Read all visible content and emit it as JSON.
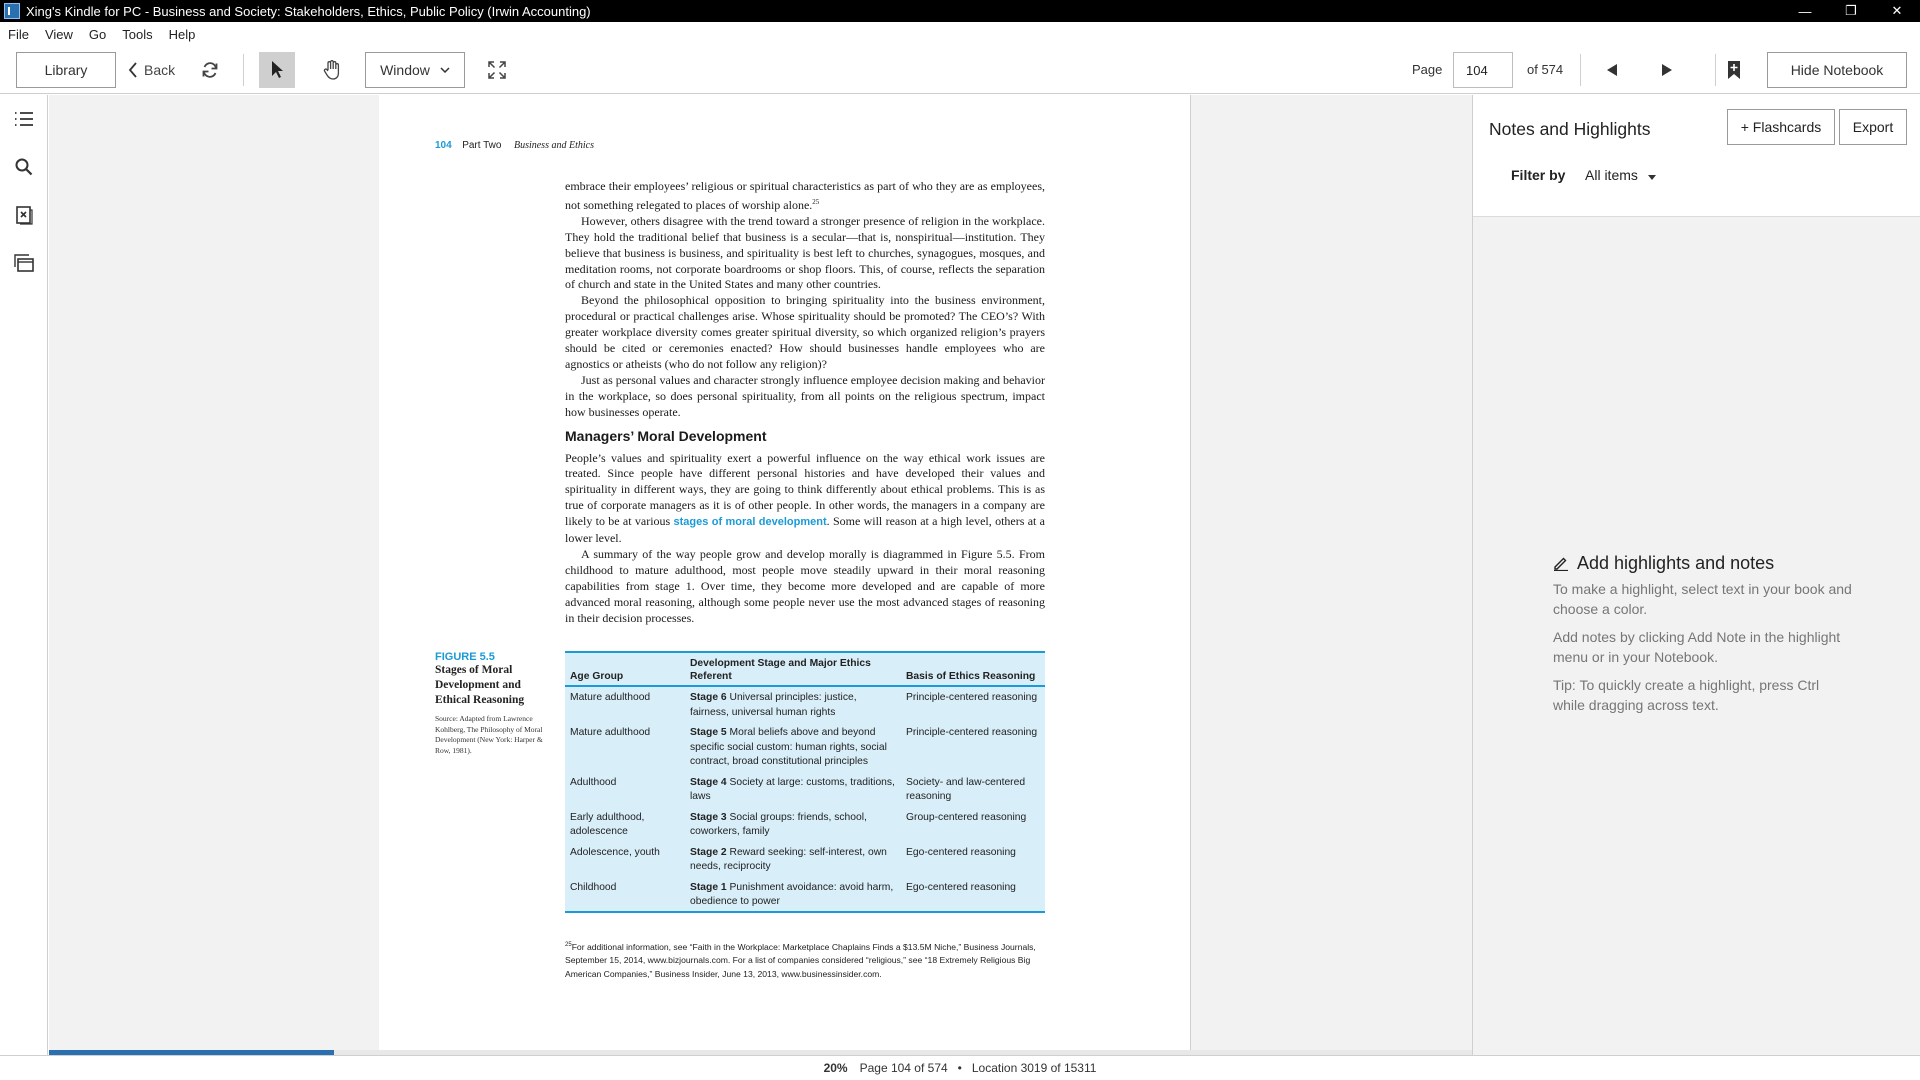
{
  "window": {
    "title": "Xing's Kindle for PC - Business and Society: Stakeholders, Ethics, Public Policy (Irwin Accounting)",
    "minimize_icon": "minimize-icon",
    "restore_icon": "restore-icon",
    "close_icon": "close-icon"
  },
  "menu": {
    "file": "File",
    "view": "View",
    "go": "Go",
    "tools": "Tools",
    "help": "Help"
  },
  "toolbar": {
    "library": "Library",
    "back": "Back",
    "view_mode": "Window",
    "page_label": "Page",
    "page_value": "104",
    "page_total": "of 574",
    "hide_notebook": "Hide Notebook"
  },
  "book_page": {
    "page_number": "104",
    "part": "Part Two",
    "book_section": "Business and Ethics",
    "para1": "embrace their employees’ religious or spiritual characteristics as part of who they are as employees, not something relegated to places of worship alone.",
    "para1_note": "25",
    "para2": "However, others disagree with the trend toward a stronger presence of religion in the workplace. They hold the traditional belief that business is a secular—that is, nonspiritual—institution. They believe that business is business, and spirituality is best left to churches, synagogues, mosques, and meditation rooms, not corporate boardrooms or shop floors. This, of course, reflects the separation of church and state in the United States and many other countries.",
    "para3": "Beyond the philosophical opposition to bringing spirituality into the business environment, procedural or practical challenges arise. Whose spirituality should be promoted? The CEO’s? With greater workplace diversity comes greater spiritual diversity, so which organized religion’s prayers should be cited or ceremonies enacted? How should businesses handle employees who are agnostics or atheists (who do not follow any religion)?",
    "para4": "Just as personal values and character strongly influence employee decision making and behavior in the workplace, so does personal spirituality, from all points on the religious spectrum, impact how businesses operate.",
    "heading": "Managers’ Moral Development",
    "para5_a": "People’s values and spirituality exert a powerful influence on the way ethical work issues are treated. Since people have different personal histories and have developed their values and spirituality in different ways, they are going to think differently about ethical problems. This is as true of corporate managers as it is of other people. In other words, the managers in a company are likely to be at various",
    "para5_link": "stages of moral development",
    "para5_b": ". Some will reason at a high level, others at a lower level.",
    "para6": "A summary of the way people grow and develop morally is diagrammed in Figure 5.5. From childhood to mature adulthood, most people move steadily upward in their moral reasoning capabilities from stage 1. Over time, they become more developed and are capable of more advanced moral reasoning, although some people never use the most advanced stages of reasoning in their decision processes.",
    "figure_label": "FIGURE 5.5",
    "figure_title": "Stages of Moral Development and Ethical Reasoning",
    "figure_source": "Source: Adapted from Lawrence Kohlberg, The Philosophy of Moral Development (New York: Harper & Row, 1981).",
    "table_headers": [
      "Age Group",
      "Development Stage and Major Ethics Referent",
      "Basis of Ethics Reasoning"
    ],
    "table_rows": [
      {
        "age": "Mature adulthood",
        "stage": "Stage 6",
        "desc": "Universal principles: justice, fairness, universal human rights",
        "basis": "Principle-centered reasoning"
      },
      {
        "age": "Mature adulthood",
        "stage": "Stage 5",
        "desc": "Moral beliefs above and beyond specific social custom: human rights, social contract, broad constitutional principles",
        "basis": "Principle-centered reasoning"
      },
      {
        "age": "Adulthood",
        "stage": "Stage 4",
        "desc": "Society at large: customs, traditions, laws",
        "basis": "Society- and law-centered reasoning"
      },
      {
        "age": "Early adulthood, adolescence",
        "stage": "Stage 3",
        "desc": "Social groups: friends, school, coworkers, family",
        "basis": "Group-centered reasoning"
      },
      {
        "age": "Adolescence, youth",
        "stage": "Stage 2",
        "desc": "Reward seeking: self-interest, own needs, reciprocity",
        "basis": "Ego-centered reasoning"
      },
      {
        "age": "Childhood",
        "stage": "Stage 1",
        "desc": "Punishment avoidance: avoid harm, obedience to power",
        "basis": "Ego-centered reasoning"
      }
    ],
    "footnote_num": "25",
    "footnote": "For additional information, see “Faith in the Workplace: Marketplace Chaplains Finds a $13.5M Niche,” Business Journals, September 15, 2014, www.bizjournals.com. For a list of companies considered “religious,” see “18 Extremely Religious Big American Companies,” Business Insider, June 13, 2013, www.businessinsider.com."
  },
  "notebook": {
    "title": "Notes and Highlights",
    "flashcards": "+ Flashcards",
    "export": "Export",
    "filter_label": "Filter by",
    "filter_value": "All items",
    "empty_title": "Add highlights and notes",
    "empty_p1": "To make a highlight, select text in your book and choose a color.",
    "empty_p2": "Add notes by clicking Add Note in the highlight menu or in your Notebook.",
    "empty_p3": "Tip: To quickly create a highlight, press Ctrl while dragging across text."
  },
  "status": {
    "percent": "20%",
    "page_info": "Page 104 of 574",
    "location": "Location 3019 of 15311",
    "progress_fraction": 0.2
  },
  "colors": {
    "accent": "#1a9ad6",
    "progress": "#2a6fb0",
    "figure_bg": "#d8eef9"
  }
}
